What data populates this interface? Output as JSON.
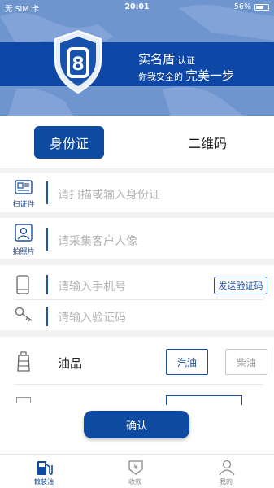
{
  "status_bar": {
    "carrier": "无 SIM 卡",
    "time": "20:01",
    "battery": "56%"
  },
  "banner": {
    "brand": "实名盾",
    "brand_suffix": "认证",
    "slogan": "你我安全的",
    "slogan_emphasis": "完美一步",
    "logo_glyph": "8"
  },
  "tabs": [
    {
      "label": "身份证",
      "active": true
    },
    {
      "label": "二维码",
      "active": false
    }
  ],
  "id_section": {
    "scan_label": "扫证件",
    "id_placeholder": "请扫描或输入身份证",
    "photo_label": "拍照片",
    "photo_placeholder": "请采集客户人像"
  },
  "phone_section": {
    "phone_placeholder": "请输入手机号",
    "send_code_label": "发送验证码",
    "code_placeholder": "请输入验证码"
  },
  "fuel_section": {
    "title": "油品",
    "options": [
      {
        "label": "汽油",
        "selected": true
      },
      {
        "label": "柴油",
        "selected": false
      }
    ]
  },
  "confirm_label": "确认",
  "nav": {
    "items": [
      {
        "label": "散装油",
        "icon": "fuel-pump-icon",
        "active": true
      },
      {
        "label": "收款",
        "icon": "receive-payment-icon",
        "active": false
      },
      {
        "label": "我的",
        "icon": "profile-icon",
        "active": false
      }
    ]
  },
  "colors": {
    "primary": "#0e4aa0",
    "banner": "#6f95cf"
  }
}
